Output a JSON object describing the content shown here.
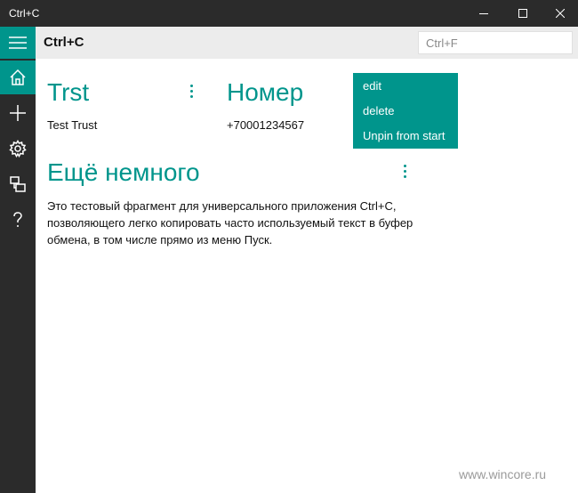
{
  "window": {
    "title": "Ctrl+C"
  },
  "header": {
    "title": "Ctrl+C",
    "search_placeholder": "Ctrl+F"
  },
  "cards": [
    {
      "title": "Trst",
      "value": "Test Trust"
    },
    {
      "title": "Номер",
      "value": "+70001234567"
    },
    {
      "title": "Ещё немного",
      "value": "Это тестовый фрагмент для универсального приложения Ctrl+C, позволяющего легко копировать часто используемый текст в буфер обмена, в том числе прямо из меню Пуск."
    }
  ],
  "context_menu": {
    "items": [
      "edit",
      "delete",
      "Unpin from start"
    ]
  },
  "watermark": "www.wincore.ru",
  "colors": {
    "accent": "#00958c",
    "sidebar": "#2b2b2b",
    "header": "#ececec"
  }
}
